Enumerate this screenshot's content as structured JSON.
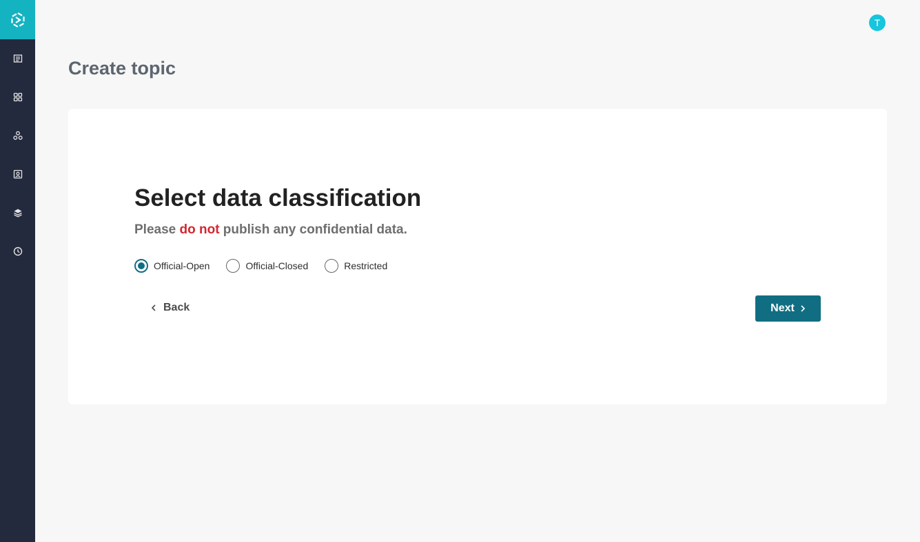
{
  "header": {
    "avatar_initial": "T"
  },
  "page": {
    "title": "Create topic"
  },
  "sidebar": {
    "accent_color": "#14b3c1",
    "items": [
      {
        "icon": "newspaper-icon"
      },
      {
        "icon": "grid-icon"
      },
      {
        "icon": "network-icon"
      },
      {
        "icon": "contact-card-icon"
      },
      {
        "icon": "layers-icon"
      },
      {
        "icon": "clock-icon"
      }
    ]
  },
  "card": {
    "heading": "Select data classification",
    "subtext_before": "Please ",
    "subtext_warning": "do not",
    "subtext_after": " publish any confidential data.",
    "warning_color": "#d3272f",
    "options": [
      {
        "label": "Official-Open",
        "selected": true
      },
      {
        "label": "Official-Closed",
        "selected": false
      },
      {
        "label": "Restricted",
        "selected": false
      }
    ],
    "back_label": "Back",
    "next_label": "Next",
    "primary_color": "#116e82"
  }
}
